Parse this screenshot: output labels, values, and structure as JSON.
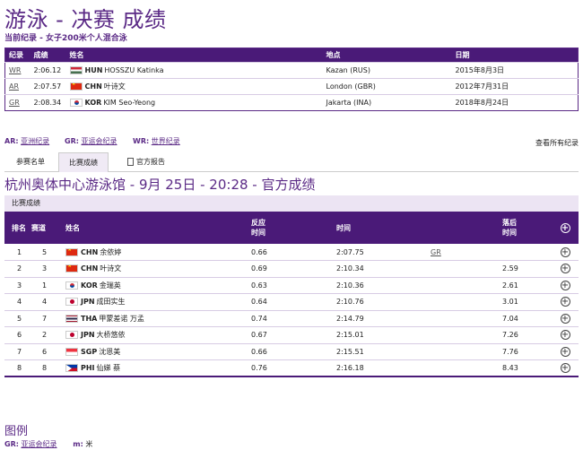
{
  "page_title": "游泳 - 决赛 成绩",
  "subtitle": "当前纪录 - 女子200米个人混合泳",
  "records": {
    "headers": [
      "纪录",
      "成绩",
      "姓名",
      "地点",
      "日期"
    ],
    "rows": [
      {
        "code": "WR",
        "result": "2:06.12",
        "noc": "HUN",
        "flag": "hun",
        "name": "HOSSZU Katinka",
        "place": "Kazan (RUS)",
        "date": "2015年8月3日"
      },
      {
        "code": "AR",
        "result": "2:07.57",
        "noc": "CHN",
        "flag": "chn",
        "name": "叶诗文",
        "place": "London (GBR)",
        "date": "2012年7月31日"
      },
      {
        "code": "GR",
        "result": "2:08.34",
        "noc": "KOR",
        "flag": "kor",
        "name": "KIM Seo-Yeong",
        "place": "Jakarta (INA)",
        "date": "2018年8月24日"
      }
    ]
  },
  "legend": {
    "ar_code": "AR:",
    "ar_label": "亚洲纪录",
    "gr_code": "GR:",
    "gr_label": "亚运会纪录",
    "wr_code": "WR:",
    "wr_label": "世界纪录"
  },
  "all_records_link": "查看所有纪录",
  "tabs": {
    "entries": "参赛名单",
    "results": "比赛成绩",
    "official_report": "官方报告"
  },
  "venue_heading": "杭州奥体中心游泳馆 - 9月 25日 - 20:28 - 官方成绩",
  "results_caption": "比赛成绩",
  "results": {
    "headers": {
      "rank": "排名",
      "lane": "赛道",
      "name": "姓名",
      "reaction": "反应\n时间",
      "time": "时间",
      "behind": "落后\n时间"
    },
    "rows": [
      {
        "rank": "1",
        "lane": "5",
        "noc": "CHN",
        "flag": "chn",
        "name": "余依婷",
        "reaction": "0.66",
        "time": "2:07.75",
        "record": "GR",
        "behind": ""
      },
      {
        "rank": "2",
        "lane": "3",
        "noc": "CHN",
        "flag": "chn",
        "name": "叶诗文",
        "reaction": "0.69",
        "time": "2:10.34",
        "record": "",
        "behind": "2.59"
      },
      {
        "rank": "3",
        "lane": "1",
        "noc": "KOR",
        "flag": "kor",
        "name": "金瑞英",
        "reaction": "0.63",
        "time": "2:10.36",
        "record": "",
        "behind": "2.61"
      },
      {
        "rank": "4",
        "lane": "4",
        "noc": "JPN",
        "flag": "jpn",
        "name": "成田实生",
        "reaction": "0.64",
        "time": "2:10.76",
        "record": "",
        "behind": "3.01"
      },
      {
        "rank": "5",
        "lane": "7",
        "noc": "THA",
        "flag": "tha",
        "name": "甲蒙差诺 万孟",
        "reaction": "0.74",
        "time": "2:14.79",
        "record": "",
        "behind": "7.04"
      },
      {
        "rank": "6",
        "lane": "2",
        "noc": "JPN",
        "flag": "jpn",
        "name": "大桥悠依",
        "reaction": "0.67",
        "time": "2:15.01",
        "record": "",
        "behind": "7.26"
      },
      {
        "rank": "7",
        "lane": "6",
        "noc": "SGP",
        "flag": "sgp",
        "name": "沈恩美",
        "reaction": "0.66",
        "time": "2:15.51",
        "record": "",
        "behind": "7.76"
      },
      {
        "rank": "8",
        "lane": "8",
        "noc": "PHI",
        "flag": "phi",
        "name": "仙娣 蔡",
        "reaction": "0.76",
        "time": "2:16.18",
        "record": "",
        "behind": "8.43"
      }
    ]
  },
  "legend_heading": "图例",
  "bottom_legend": {
    "gr_code": "GR:",
    "gr_label": "亚运会纪录",
    "m_code": "m:",
    "m_label": "米"
  }
}
